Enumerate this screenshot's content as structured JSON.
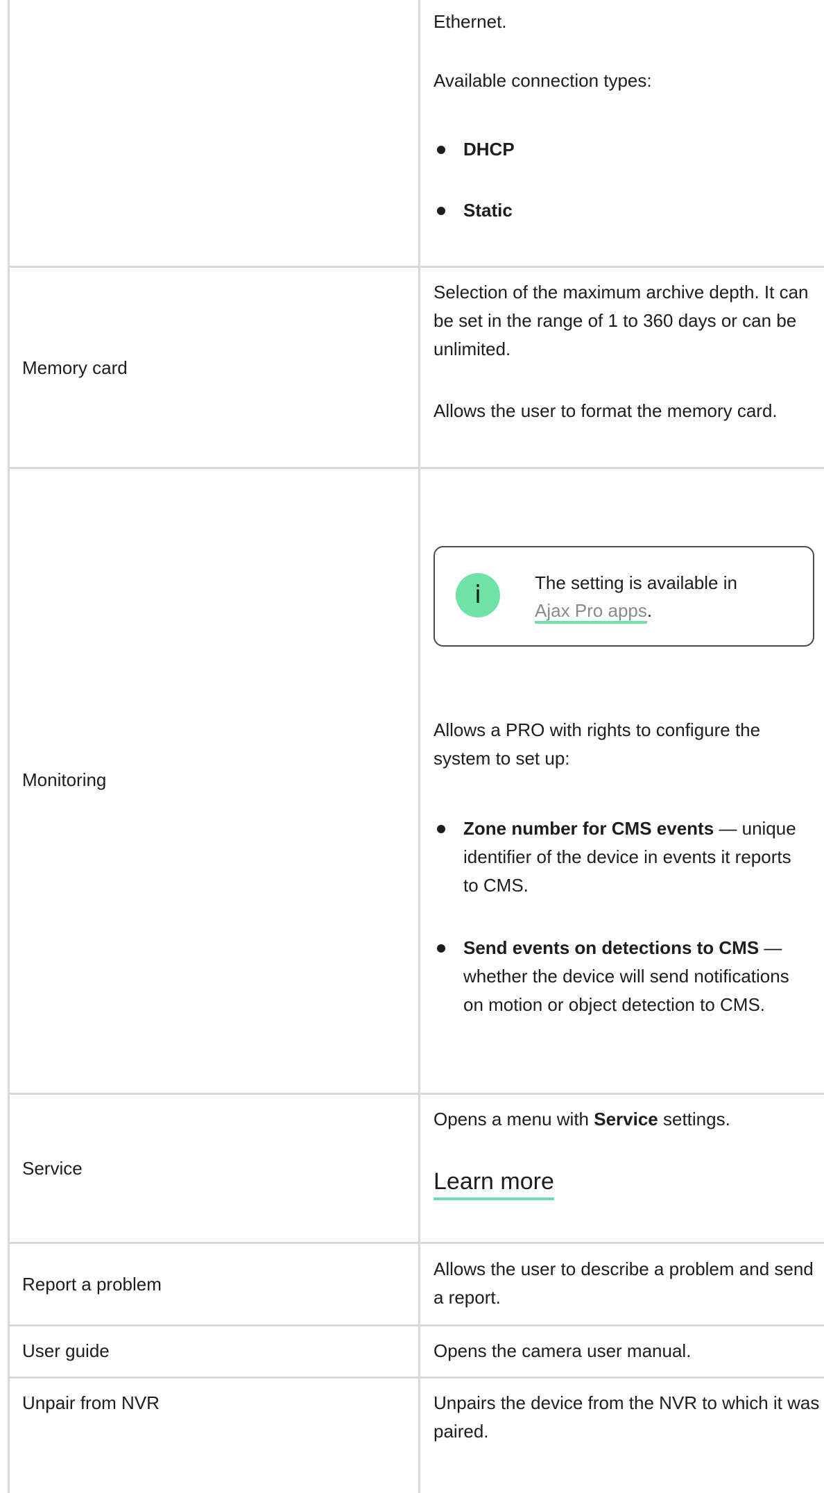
{
  "rows": {
    "ethernet": {
      "continued_text": "Ethernet.",
      "intro": "Available connection types:",
      "options": [
        "DHCP",
        "Static"
      ]
    },
    "memory_card": {
      "label": "Memory card",
      "description": "Selection of the maximum archive depth. It can be set in the range of 1 to 360 days or can be unlimited.",
      "format_text": "Allows the user to format the memory card."
    },
    "monitoring": {
      "label": "Monitoring",
      "info": {
        "icon": "info-icon",
        "text": "The setting is available in",
        "link": "Ajax Pro apps",
        "after": "."
      },
      "intro": "Allows a PRO with rights to configure the system to set up:",
      "items": [
        {
          "title": "Zone number for CMS events",
          "rest": " — unique identifier of the device in events it reports to CMS."
        },
        {
          "title": "Send events on detections to CMS",
          "rest": " — whether the device will send notifications on motion or object detection to CMS."
        }
      ]
    },
    "service": {
      "label": "Service",
      "text_before": "Opens a menu with ",
      "bold": "Service",
      "text_after": " settings.",
      "link": "Learn more"
    },
    "report_problem": {
      "label": "Report a problem",
      "description": "Allows the user to describe a problem and send a report."
    },
    "user_guide": {
      "label": "User guide",
      "description": "Opens the camera user manual."
    },
    "unpair": {
      "label": "Unpair from NVR",
      "description": "Unpairs the device from the NVR to which it was paired."
    }
  },
  "colors": {
    "accent": "#6fe3a5",
    "border": "#d9d9d9",
    "text": "#1d1d1d",
    "link_muted": "#8a8a8a"
  }
}
